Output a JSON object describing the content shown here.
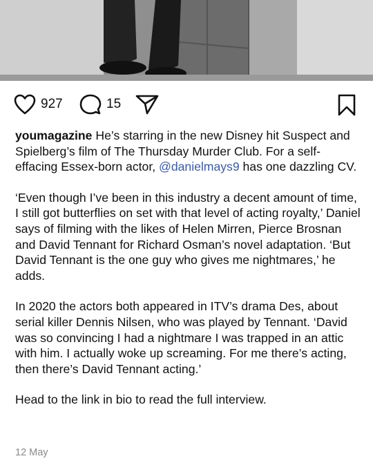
{
  "post": {
    "likes": "927",
    "comments": "15",
    "username": "youmagazine",
    "caption_intro_pre": " He’s starring in the new Disney hit Suspect and Spielberg’s film of The Thursday Murder Club. For a self-effacing Essex-born actor, ",
    "mention": "@danielmays9",
    "caption_intro_post": " has one dazzling CV.",
    "paragraphs": [
      "‘Even though I’ve been in this industry a decent amount of time, I still got butterflies on set with that level of acting royalty,’ Daniel says of filming with the likes of Helen Mirren, Pierce Brosnan and David Tennant for Richard Osman’s novel adaptation. ‘But David Tennant is the one guy who gives me nightmares,’ he adds.",
      "In 2020 the actors both appeared in ITV’s drama Des, about serial killer Dennis Nilsen, who was played by Tennant. ‘David was so convincing I had a nightmare I was trapped in an attic with him. I actually woke up screaming. For me there’s acting, then there’s David Tennant acting.’",
      "Head to the link in bio to read the full interview."
    ],
    "date": "12 May"
  },
  "icons": {
    "like": "heart-icon",
    "comment": "comment-bubble-icon",
    "share": "paper-plane-icon",
    "save": "bookmark-icon"
  },
  "colors": {
    "mention": "#3b5aa4",
    "date": "#8a8a8a"
  }
}
